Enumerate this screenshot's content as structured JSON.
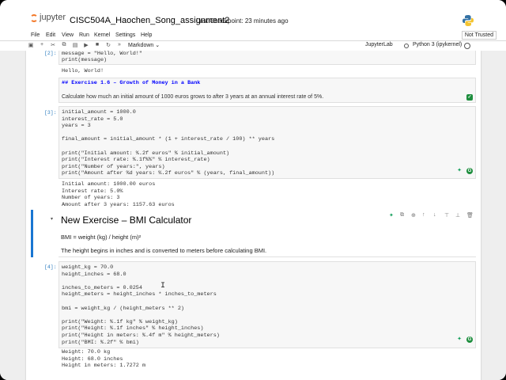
{
  "header": {
    "logo_text": "jupyter",
    "notebook_title": "CISC504A_Haochen_Song_assignment2",
    "checkpoint": "Last Checkpoint: 23 minutes ago"
  },
  "menu": {
    "items": [
      "File",
      "Edit",
      "View",
      "Run",
      "Kernel",
      "Settings",
      "Help"
    ],
    "trust_status": "Not Trusted"
  },
  "toolbar": {
    "buttons": [
      "save-icon",
      "add-icon",
      "cut-icon",
      "copy-icon",
      "paste-icon",
      "run-icon",
      "stop-icon",
      "restart-icon",
      "fast-forward-icon"
    ],
    "cell_type": "Markdown",
    "jupyterlab_label": "JupyterLab",
    "kernel_name": "Python 3 (ipykernel)"
  },
  "cells": {
    "c1": {
      "prompt": "[2]:",
      "code": [
        "message = \"Hello, World!\"",
        "print(message)"
      ],
      "output": "Hello, World!"
    },
    "c2": {
      "heading": "## Exercise 1.6 – Growth of Money in a Bank",
      "text": "Calculate how much an initial amount of 1000 euros grows to after 3 years at an annual interest rate of 5%."
    },
    "c3": {
      "prompt": "[3]:",
      "code": [
        "initial_amount = 1000.0",
        "interest_rate = 5.0",
        "years = 3",
        "",
        "final_amount = initial_amount * (1 + interest_rate / 100) ** years",
        "",
        "print(\"Initial amount: %.2f euros\" % initial_amount)",
        "print(\"Interest rate: %.1f%%\" % interest_rate)",
        "print(\"Number of years:\", years)",
        "print(\"Amount after %d years: %.2f euros\" % (years, final_amount))"
      ],
      "output": [
        "Initial amount: 1000.00 euros",
        "Interest rate: 5.0%",
        "Number of years: 3",
        "Amount after 3 years: 1157.63 euros"
      ]
    },
    "c4": {
      "heading": "New Exercise – BMI Calculator",
      "formula": "BMI = weight (kg) / height (m)²",
      "text": "The height begins in inches and is converted to meters before calculating BMI."
    },
    "c5": {
      "prompt": "[4]:",
      "code": [
        "weight_kg = 70.0",
        "height_inches = 68.0",
        "",
        "inches_to_meters = 0.0254",
        "height_meters = height_inches * inches_to_meters",
        "",
        "bmi = weight_kg / (height_meters ** 2)",
        "",
        "print(\"Weight: %.1f kg\" % weight_kg)",
        "print(\"Height: %.1f inches\" % height_inches)",
        "print(\"Height in meters: %.4f m\" % height_meters)",
        "print(\"BMI: %.2f\" % bmi)"
      ],
      "output": [
        "Weight: 70.0 kg",
        "Height: 68.0 inches",
        "Height in meters: 1.7272 m"
      ]
    }
  },
  "colors": {
    "accent_orange": "#f37726",
    "selection_blue": "#1976d2",
    "prompt_blue": "#307fc1",
    "md_heading_blue": "#0000ff"
  }
}
